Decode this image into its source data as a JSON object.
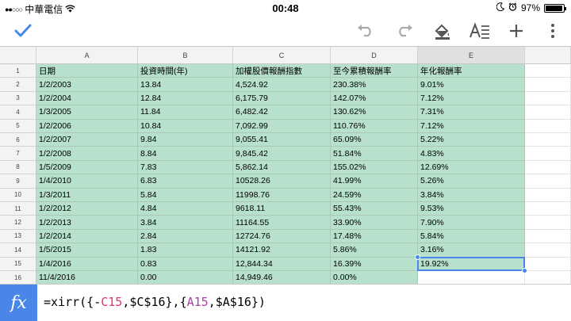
{
  "status": {
    "carrier": "中華電信",
    "time": "00:48",
    "battery": "97%",
    "battery_level": 0.97
  },
  "toolbar": {
    "icons": [
      "check-icon",
      "undo-icon",
      "redo-icon",
      "fill-color-icon",
      "text-format-icon",
      "plus-icon",
      "more-icon"
    ]
  },
  "sheet": {
    "columns": [
      "A",
      "B",
      "C",
      "D",
      "E"
    ],
    "rows": [
      {
        "n": "1",
        "cells": [
          "日期",
          "投資時間(年)",
          "加權股價報酬指數",
          "至今累積報酬率",
          "年化報酬率"
        ]
      },
      {
        "n": "2",
        "cells": [
          "1/2/2003",
          "13.84",
          "4,524.92",
          "230.38%",
          "9.01%"
        ]
      },
      {
        "n": "3",
        "cells": [
          "1/2/2004",
          "12.84",
          "6,175.79",
          "142.07%",
          "7.12%"
        ]
      },
      {
        "n": "4",
        "cells": [
          "1/3/2005",
          "11.84",
          "6,482.42",
          "130.62%",
          "7.31%"
        ]
      },
      {
        "n": "5",
        "cells": [
          "1/2/2006",
          "10.84",
          "7,092.99",
          "110.76%",
          "7.12%"
        ]
      },
      {
        "n": "6",
        "cells": [
          "1/2/2007",
          "9.84",
          "9,055.41",
          "65.09%",
          "5.22%"
        ]
      },
      {
        "n": "7",
        "cells": [
          "1/2/2008",
          "8.84",
          "9,845.42",
          "51.84%",
          "4.83%"
        ]
      },
      {
        "n": "8",
        "cells": [
          "1/5/2009",
          "7.83",
          "5,862.14",
          "155.02%",
          "12.69%"
        ]
      },
      {
        "n": "9",
        "cells": [
          "1/4/2010",
          "6.83",
          "10528.26",
          "41.99%",
          "5.26%"
        ]
      },
      {
        "n": "10",
        "cells": [
          "1/3/2011",
          "5.84",
          "11998.76",
          "24.59%",
          "3.84%"
        ]
      },
      {
        "n": "11",
        "cells": [
          "1/2/2012",
          "4.84",
          "9618.11",
          "55.43%",
          "9.53%"
        ]
      },
      {
        "n": "12",
        "cells": [
          "1/2/2013",
          "3.84",
          "11164.55",
          "33.90%",
          "7.90%"
        ]
      },
      {
        "n": "13",
        "cells": [
          "1/2/2014",
          "2.84",
          "12724.76",
          "17.48%",
          "5.84%"
        ]
      },
      {
        "n": "14",
        "cells": [
          "1/5/2015",
          "1.83",
          "14121.92",
          "5.86%",
          "3.16%"
        ]
      },
      {
        "n": "15",
        "cells": [
          "1/4/2016",
          "0.83",
          "12,844.34",
          "16.39%",
          "19.92%"
        ]
      },
      {
        "n": "16",
        "cells": [
          "11/4/2016",
          "0.00",
          "14,949.46",
          "0.00%",
          ""
        ]
      }
    ]
  },
  "formula_bar": {
    "fx_label": "fx",
    "tokens": [
      {
        "t": "=xirr({-",
        "k": "plain"
      },
      {
        "t": "C15",
        "k": "ref-c"
      },
      {
        "t": ",$C$16},{",
        "k": "plain"
      },
      {
        "t": "A15",
        "k": "ref-a"
      },
      {
        "t": ",$A$16})",
        "k": "plain"
      }
    ]
  },
  "colors": {
    "accent": "#4a86e8",
    "cell_fill": "#b7e1cd"
  }
}
